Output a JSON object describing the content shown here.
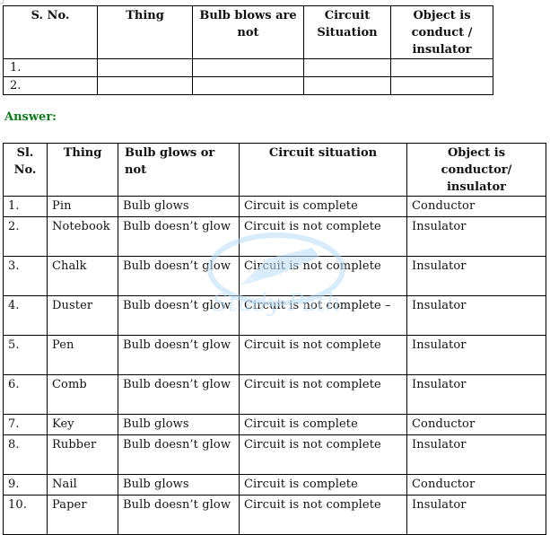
{
  "question_table": {
    "headers": [
      "S. No.",
      "Thing",
      "Bulb blows are not",
      "Circuit Situation",
      "Object is conduct / insulator"
    ],
    "rows": [
      [
        "1.",
        "",
        "",
        "",
        ""
      ],
      [
        "2.",
        "",
        "",
        "",
        ""
      ]
    ]
  },
  "answer_label": "Answer:",
  "answer_table": {
    "headers": [
      "Sl. No.",
      "Thing",
      "Bulb glows or not",
      "Circuit situation",
      "Object is conductor/ insulator"
    ],
    "rows": [
      [
        "1.",
        "Pin",
        "Bulb glows",
        "Circuit is complete",
        "Conductor"
      ],
      [
        "2.",
        "Notebook",
        "Bulb doesn’t glow",
        "Circuit is not complete",
        "Insulator"
      ],
      [
        "3.",
        "Chalk",
        "Bulb doesn’t glow",
        "Circuit is not complete",
        "Insulator"
      ],
      [
        "4.",
        "Duster",
        "Bulb doesn’t glow",
        "Circuit is not complete –",
        "Insulator"
      ],
      [
        "5.",
        "Pen",
        "Bulb doesn’t glow",
        "Circuit is not complete",
        "Insulator"
      ],
      [
        "6.",
        "Comb",
        "Bulb doesn’t glow",
        "Circuit is not complete",
        "Insulator"
      ],
      [
        "7.",
        "Key",
        "Bulb glows",
        "Circuit is complete",
        "Conductor"
      ],
      [
        "8.",
        "Rubber",
        "Bulb doesn’t glow",
        "Circuit is not complete",
        "Insulator"
      ],
      [
        "9.",
        "Nail",
        "Bulb glows",
        "Circuit is complete",
        "Conductor"
      ],
      [
        "10.",
        "Paper",
        "Bulb doesn’t glow",
        "Circuit is not complete",
        "Insulator"
      ]
    ]
  },
  "watermark": {
    "text": "Study Path",
    "icon": "fountain-pen-icon",
    "color": "#9fd0f5"
  },
  "colors": {
    "answer_label": "#0b7a1a",
    "border": "#000000"
  }
}
